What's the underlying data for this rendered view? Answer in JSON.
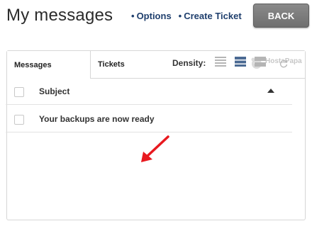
{
  "header": {
    "title": "My messages",
    "links": [
      {
        "label": "Options"
      },
      {
        "label": "Create Ticket"
      }
    ],
    "back_label": "BACK"
  },
  "tabs": [
    {
      "label": "Messages",
      "active": true
    },
    {
      "label": "Tickets",
      "active": false
    }
  ],
  "brand": {
    "name": "HostaPapa"
  },
  "toolbar": {
    "density_label": "Density:",
    "density_options": [
      "compact-icon",
      "normal-icon",
      "comfortable-icon"
    ],
    "selected_density": 1
  },
  "table": {
    "columns": [
      {
        "label": "Subject",
        "sort": "ascending"
      }
    ],
    "rows": [
      {
        "subject": "Your backups are now ready"
      }
    ]
  },
  "colors": {
    "link": "#1f3f6d",
    "button_bg": "#7a7a7a",
    "density_active": "#4b6a93",
    "density_inactive": "#b5b5b5",
    "annotation_arrow": "#e8191f"
  }
}
